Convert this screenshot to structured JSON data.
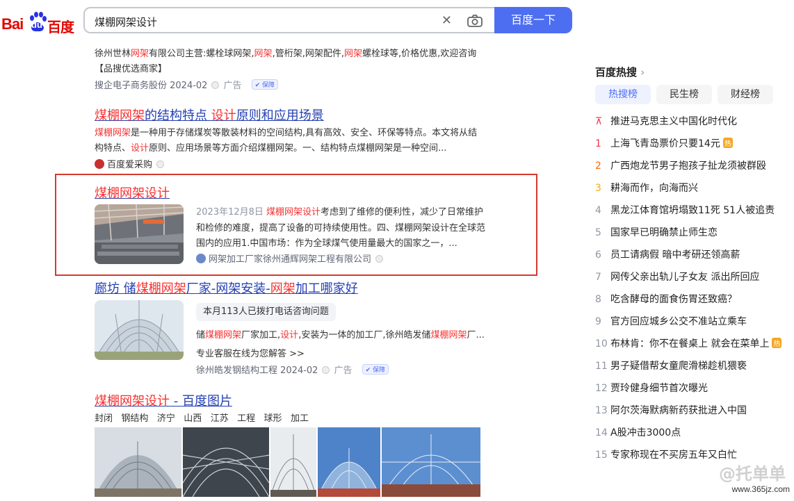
{
  "logo": {
    "bai": "Bai",
    "du": "du",
    "cn": "百度"
  },
  "search": {
    "query": "煤棚网架设计",
    "button": "百度一下"
  },
  "result1": {
    "line1_parts": [
      "徐州世林",
      "网架",
      "有限公司主营:螺栓球网架,",
      "网架",
      ",管桁架,网架配件,",
      "网架",
      "螺栓球等,价格优惠,欢迎咨询"
    ],
    "line2": "【品搜优选商家】",
    "source": "搜企电子商务股份 2024-02",
    "ad": "广告",
    "badge": "保障"
  },
  "result2": {
    "title_em1": "煤棚网架",
    "title_mid": "的结构特点 ",
    "title_em2": "设计",
    "title_end": "原则和应用场景",
    "desc1_em": "煤棚网架",
    "desc1": "是一种用于存储煤炭等散装材料的空间结构,具有高效、安全、环保等特点。本文将从结",
    "desc2_a": "构特点、",
    "desc2_em": "设计",
    "desc2_b": "原则、应用场景等方面介绍煤棚网架。一、结构特点煤棚网架是一种空间...",
    "source": "百度爱采购"
  },
  "result3": {
    "title": "煤棚网架设计",
    "date": "2023年12月8日 ",
    "desc1_em": "煤棚网架设计",
    "desc1": "考虑到了维修的便利性，减少了日常维护",
    "desc2": "和检修的难度，提高了设备的可持续使用性。四、煤棚网架设计在全球范",
    "desc3": "围内的应用1.中国市场：作为全球煤气使用量最大的国家之一，...",
    "source": "网架加工厂家徐州通辉网架工程有限公司"
  },
  "result4": {
    "title_a": "廊坊 储",
    "title_em1": "煤棚网架",
    "title_b": "厂家-网架安装-",
    "title_em2": "网架",
    "title_c": "加工哪家好",
    "tag": "本月113人已拨打电话咨询问题",
    "desc_a": "储",
    "desc_em1": "煤棚网架",
    "desc_b": "厂家加工,",
    "desc_em2": "设计",
    "desc_c": ",安装为一体的加工厂,徐州皓发储",
    "desc_em3": "煤棚网架",
    "desc_d": "厂...",
    "cta": "专业客服在线为您解答 >>",
    "source": "徐州皓发钢结构工程 2024-02",
    "ad": "广告",
    "badge": "保障"
  },
  "result5": {
    "title_em": "煤棚网架设计",
    "title_rest": " - 百度图片",
    "tags": [
      "封闭",
      "钢结构",
      "济宁",
      "山西",
      "江苏",
      "工程",
      "球形",
      "加工"
    ]
  },
  "hot": {
    "title": "百度热搜",
    "tabs": [
      "热搜榜",
      "民生榜",
      "财经榜"
    ],
    "items": [
      {
        "rank": "",
        "text": "推进马克思主义中国化时代化",
        "fire": ""
      },
      {
        "rank": "1",
        "text": "上海飞青岛票价只要14元",
        "fire": "热"
      },
      {
        "rank": "2",
        "text": "广西炮龙节男子抱孩子扯龙须被群殴",
        "fire": ""
      },
      {
        "rank": "3",
        "text": "耕海而作，向海而兴",
        "fire": ""
      },
      {
        "rank": "4",
        "text": "黑龙江体育馆坍塌致11死 51人被追责",
        "fire": ""
      },
      {
        "rank": "5",
        "text": "国家早已明确禁止师生恋",
        "fire": ""
      },
      {
        "rank": "6",
        "text": "员工请病假 暗中考研还领高薪",
        "fire": ""
      },
      {
        "rank": "7",
        "text": "网传父亲出轨儿子女友 派出所回应",
        "fire": ""
      },
      {
        "rank": "8",
        "text": "吃含酵母的面食伤胃还致癌？",
        "fire": ""
      },
      {
        "rank": "9",
        "text": "官方回应城乡公交不准站立乘车",
        "fire": ""
      },
      {
        "rank": "10",
        "text": "布林肯：你不在餐桌上 就会在菜单上",
        "fire": "热"
      },
      {
        "rank": "11",
        "text": "男子疑借帮女童爬滑梯趁机猥亵",
        "fire": ""
      },
      {
        "rank": "12",
        "text": "贾玲健身细节首次曝光",
        "fire": ""
      },
      {
        "rank": "13",
        "text": "阿尔茨海默病新药获批进入中国",
        "fire": ""
      },
      {
        "rank": "14",
        "text": "A股冲击3000点",
        "fire": ""
      },
      {
        "rank": "15",
        "text": "专家称现在不买房五年又白忙",
        "fire": ""
      }
    ]
  },
  "watermark": {
    "text": "@托单单",
    "url": "www.365jz.com"
  }
}
